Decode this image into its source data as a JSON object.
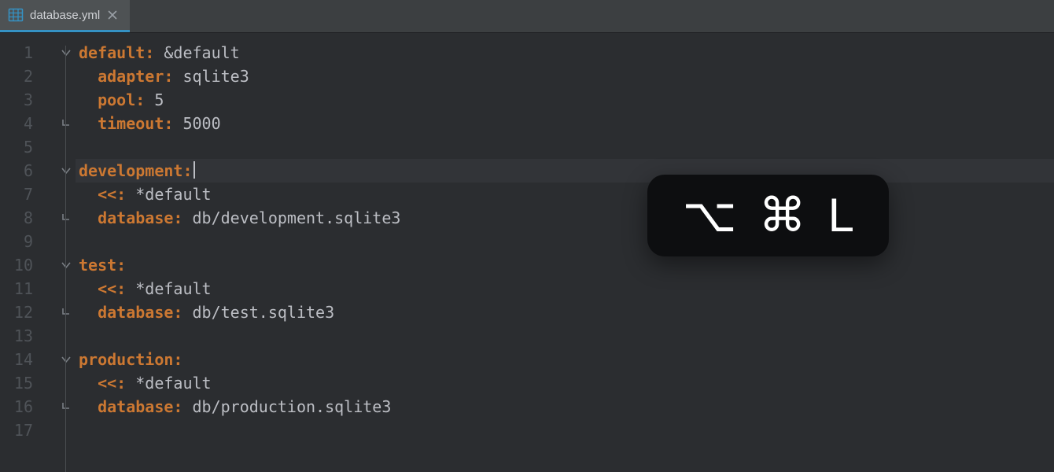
{
  "tab": {
    "filename": "database.yml",
    "icon": "table-icon",
    "active": true
  },
  "editor": {
    "current_line": 6,
    "lines": [
      {
        "n": 1,
        "fold": "open",
        "tokens": [
          [
            "k",
            "default:"
          ],
          [
            "d",
            " &default"
          ]
        ]
      },
      {
        "n": 2,
        "fold": null,
        "indent": 1,
        "tokens": [
          [
            "k",
            "adapter:"
          ],
          [
            "d",
            " sqlite3"
          ]
        ]
      },
      {
        "n": 3,
        "fold": null,
        "indent": 1,
        "tokens": [
          [
            "k",
            "pool:"
          ],
          [
            "d",
            " 5"
          ]
        ]
      },
      {
        "n": 4,
        "fold": "end",
        "indent": 1,
        "tokens": [
          [
            "k",
            "timeout:"
          ],
          [
            "d",
            " 5000"
          ]
        ]
      },
      {
        "n": 5,
        "fold": null,
        "tokens": []
      },
      {
        "n": 6,
        "fold": "open",
        "tokens": [
          [
            "k",
            "development:"
          ]
        ],
        "caret": true
      },
      {
        "n": 7,
        "fold": null,
        "indent": 1,
        "tokens": [
          [
            "k",
            "<<:"
          ],
          [
            "d",
            " *default"
          ]
        ]
      },
      {
        "n": 8,
        "fold": "end",
        "indent": 1,
        "tokens": [
          [
            "k",
            "database:"
          ],
          [
            "d",
            " db/development.sqlite3"
          ]
        ]
      },
      {
        "n": 9,
        "fold": null,
        "tokens": []
      },
      {
        "n": 10,
        "fold": "open",
        "tokens": [
          [
            "k",
            "test:"
          ]
        ]
      },
      {
        "n": 11,
        "fold": null,
        "indent": 1,
        "tokens": [
          [
            "k",
            "<<:"
          ],
          [
            "d",
            " *default"
          ]
        ]
      },
      {
        "n": 12,
        "fold": "end",
        "indent": 1,
        "tokens": [
          [
            "k",
            "database:"
          ],
          [
            "d",
            " db/test.sqlite3"
          ]
        ]
      },
      {
        "n": 13,
        "fold": null,
        "tokens": []
      },
      {
        "n": 14,
        "fold": "open",
        "tokens": [
          [
            "k",
            "production:"
          ]
        ]
      },
      {
        "n": 15,
        "fold": null,
        "indent": 1,
        "tokens": [
          [
            "k",
            "<<:"
          ],
          [
            "d",
            " *default"
          ]
        ]
      },
      {
        "n": 16,
        "fold": "end",
        "indent": 1,
        "tokens": [
          [
            "k",
            "database:"
          ],
          [
            "d",
            " db/production.sqlite3"
          ]
        ]
      },
      {
        "n": 17,
        "fold": null,
        "tokens": []
      }
    ]
  },
  "shortcut": {
    "keys": [
      "option",
      "command",
      "L"
    ],
    "glyphs": [
      "⌥",
      "⌘",
      "L"
    ]
  },
  "colors": {
    "bg": "#2b2d30",
    "tabbar": "#3c3f41",
    "accent": "#3592c4",
    "key": "#cc7832",
    "text": "#bcbec4"
  }
}
